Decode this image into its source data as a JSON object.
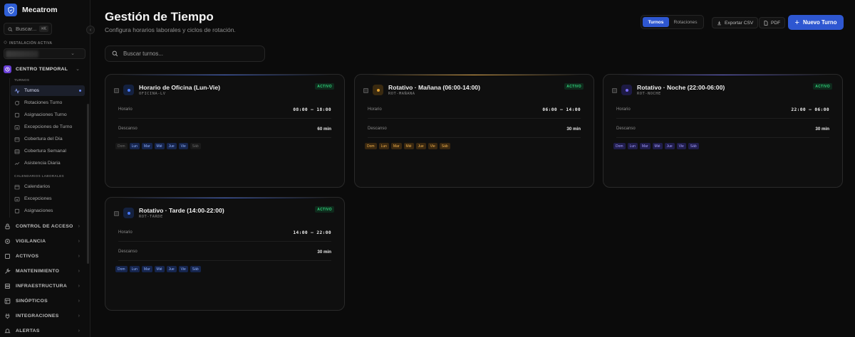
{
  "sidebar": {
    "brand": "Mecatrom",
    "search_label": "Buscar...",
    "search_shortcut": "⌘K",
    "installation_label": "INSTALACIÓN ACTIVA",
    "section_title": "CENTRO TEMPORAL",
    "group1_label": "TURNOS",
    "group1_items": [
      {
        "label": "Turnos",
        "icon": "activity-icon",
        "active": true
      },
      {
        "label": "Rotaciones Turno",
        "icon": "rotate-icon"
      },
      {
        "label": "Asignaciones Turno",
        "icon": "assign-icon"
      },
      {
        "label": "Excepciones de Turno",
        "icon": "calendar-x-icon"
      },
      {
        "label": "Cobertura del Día",
        "icon": "calendar-icon"
      },
      {
        "label": "Cobertura Semanal",
        "icon": "calendar-week-icon"
      },
      {
        "label": "Asistencia Diaria",
        "icon": "trend-icon"
      }
    ],
    "group2_label": "CALENDARIOS LABORALES",
    "group2_items": [
      {
        "label": "Calendarios",
        "icon": "calendar-icon"
      },
      {
        "label": "Excepciones",
        "icon": "calendar-x-icon"
      },
      {
        "label": "Asignaciones",
        "icon": "assign-icon"
      }
    ],
    "sections": [
      {
        "label": "CONTROL DE ACCESO",
        "icon": "lock-icon"
      },
      {
        "label": "VIGILANCIA",
        "icon": "camera-icon"
      },
      {
        "label": "ACTIVOS",
        "icon": "box-icon"
      },
      {
        "label": "MANTENIMIENTO",
        "icon": "wrench-icon"
      },
      {
        "label": "INFRAESTRUCTURA",
        "icon": "server-icon"
      },
      {
        "label": "SINÓPTICOS",
        "icon": "layout-icon"
      },
      {
        "label": "INTEGRACIONES",
        "icon": "plug-icon"
      },
      {
        "label": "ALERTAS",
        "icon": "bell-icon"
      }
    ]
  },
  "header": {
    "title": "Gestión de Tiempo",
    "subtitle": "Configura horarios laborales y ciclos de rotación.",
    "tab_shifts": "Turnos",
    "tab_rotations": "Rotaciones",
    "export_csv": "Exportar CSV",
    "pdf": "PDF",
    "new_shift": "Nuevo Turno"
  },
  "search": {
    "placeholder": "Buscar turnos..."
  },
  "colors": {
    "accent": "#2e57d1",
    "active_green": "#2fd27a",
    "office": "#4a7bff",
    "morning": "#e0a030",
    "night": "#7a6cff"
  },
  "cards": [
    {
      "title": "Horario de Oficina (Lun-Vie)",
      "code": "OFICINA-LV",
      "status": "ACTIVO",
      "schedule_label": "Horario",
      "schedule": "08:00 – 18:00",
      "break_label": "Descanso",
      "break": "60 min",
      "days": [
        {
          "label": "Dom",
          "on": false
        },
        {
          "label": "Lun",
          "on": true
        },
        {
          "label": "Mar",
          "on": true
        },
        {
          "label": "Mié",
          "on": true
        },
        {
          "label": "Jue",
          "on": true
        },
        {
          "label": "Vie",
          "on": true
        },
        {
          "label": "Sáb",
          "on": false
        }
      ]
    },
    {
      "title": "Rotativo · Mañana (06:00-14:00)",
      "code": "ROT-MAÑANA",
      "status": "ACTIVO",
      "schedule_label": "Horario",
      "schedule": "06:00 – 14:00",
      "break_label": "Descanso",
      "break": "30 min",
      "days": [
        {
          "label": "Dom",
          "on": true
        },
        {
          "label": "Lun",
          "on": true
        },
        {
          "label": "Mar",
          "on": true
        },
        {
          "label": "Mié",
          "on": true
        },
        {
          "label": "Jue",
          "on": true
        },
        {
          "label": "Vie",
          "on": true
        },
        {
          "label": "Sáb",
          "on": true
        }
      ]
    },
    {
      "title": "Rotativo · Noche (22:00-06:00)",
      "code": "ROT-NOCHE",
      "status": "ACTIVO",
      "schedule_label": "Horario",
      "schedule": "22:00 – 06:00",
      "break_label": "Descanso",
      "break": "30 min",
      "days": [
        {
          "label": "Dom",
          "on": true
        },
        {
          "label": "Lun",
          "on": true
        },
        {
          "label": "Mar",
          "on": true
        },
        {
          "label": "Mié",
          "on": true
        },
        {
          "label": "Jue",
          "on": true
        },
        {
          "label": "Vie",
          "on": true
        },
        {
          "label": "Sáb",
          "on": true
        }
      ]
    },
    {
      "title": "Rotativo · Tarde (14:00-22:00)",
      "code": "ROT-TARDE",
      "status": "ACTIVO",
      "schedule_label": "Horario",
      "schedule": "14:00 – 22:00",
      "break_label": "Descanso",
      "break": "30 min",
      "days": [
        {
          "label": "Dom",
          "on": true
        },
        {
          "label": "Lun",
          "on": true
        },
        {
          "label": "Mar",
          "on": true
        },
        {
          "label": "Mié",
          "on": true
        },
        {
          "label": "Jue",
          "on": true
        },
        {
          "label": "Vie",
          "on": true
        },
        {
          "label": "Sáb",
          "on": true
        }
      ]
    }
  ]
}
